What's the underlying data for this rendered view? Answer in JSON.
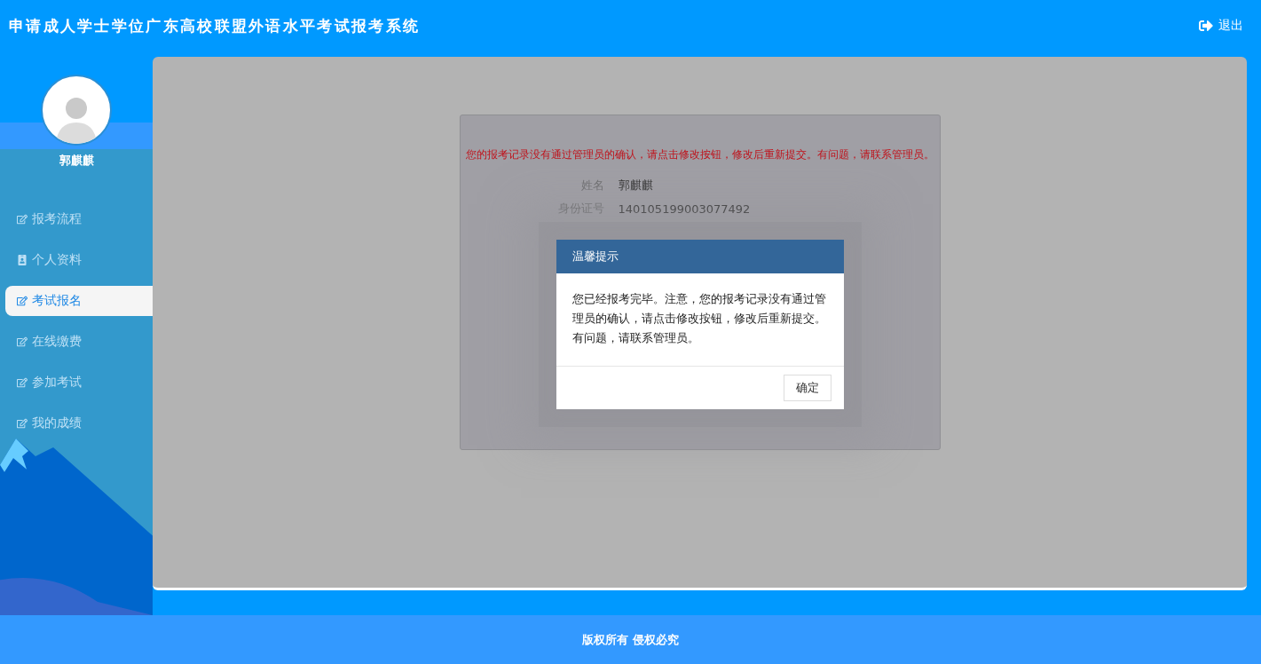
{
  "header": {
    "title": "申请成人学士学位广东高校联盟外语水平考试报考系统",
    "logout": "退出"
  },
  "user": {
    "name": "郭麒麒"
  },
  "menu": [
    {
      "label": "报考流程",
      "kind": "edit",
      "selected": false
    },
    {
      "label": "个人资料",
      "kind": "card",
      "selected": false
    },
    {
      "label": "考试报名",
      "kind": "edit",
      "selected": true
    },
    {
      "label": "在线缴费",
      "kind": "edit",
      "selected": false
    },
    {
      "label": "参加考试",
      "kind": "edit",
      "selected": false
    },
    {
      "label": "我的成绩",
      "kind": "edit",
      "selected": false
    }
  ],
  "record": {
    "warning": "您的报考记录没有通过管理员的确认，请点击修改按钮，修改后重新提交。有问题，请联系管理员。",
    "fields": [
      {
        "label": "姓名",
        "value": "郭麒麒"
      },
      {
        "label": "身份证号",
        "value": "140105199003077492"
      }
    ]
  },
  "dialog": {
    "title": "温馨提示",
    "message": "您已经报考完毕。注意，您的报考记录没有通过管理员的确认，请点击修改按钮，修改后重新提交。有问题，请联系管理员。",
    "button": "确定"
  },
  "footer": {
    "text": "版权所有 侵权必究"
  }
}
